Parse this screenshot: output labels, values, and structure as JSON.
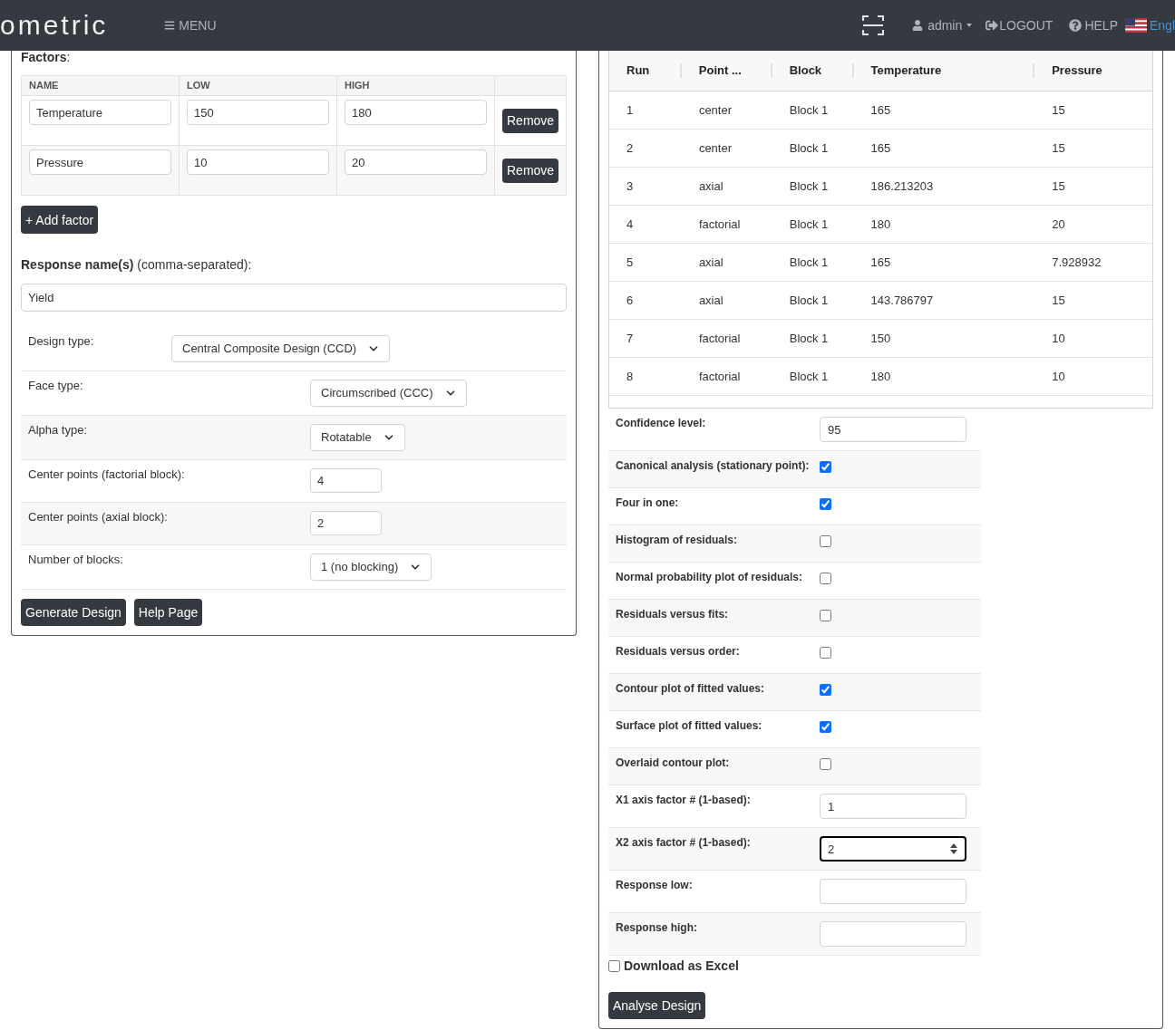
{
  "navbar": {
    "logo": "ometric",
    "menu": "MENU",
    "user": "admin",
    "logout": "LOGOUT",
    "help": "HELP",
    "language": "Engl"
  },
  "factors": {
    "title": "**Factors**:",
    "columns": [
      "NAME",
      "LOW",
      "HIGH"
    ],
    "rows": [
      {
        "name": "Temperature",
        "low": "150",
        "high": "180",
        "action": "Remove"
      },
      {
        "name": "Pressure",
        "low": "10",
        "high": "20",
        "action": "Remove"
      }
    ],
    "add_button": "+ Add factor"
  },
  "response": {
    "label": "**Response name(s)** (comma-separated):",
    "value": "Yield"
  },
  "design_type": {
    "label": "Design type:",
    "value": "Central Composite Design (CCD)"
  },
  "settings": [
    {
      "kind": "select",
      "label": "Face type:",
      "value": "Circumscribed (CCC)"
    },
    {
      "kind": "select",
      "label": "Alpha type:",
      "value": "Rotatable"
    },
    {
      "kind": "input",
      "label": "Center points (factorial block):",
      "value": "4"
    },
    {
      "kind": "input",
      "label": "Center points (axial block):",
      "value": "2"
    },
    {
      "kind": "select",
      "label": "Number of blocks:",
      "value": "1 (no blocking)"
    }
  ],
  "design_buttons": [
    "Generate Design",
    "Help Page"
  ],
  "design_table": {
    "columns": [
      "Run",
      "Point ...",
      "Block",
      "Temperature",
      "Pressure"
    ],
    "rows": [
      [
        "1",
        "center",
        "Block 1",
        "165",
        "15"
      ],
      [
        "2",
        "center",
        "Block 1",
        "165",
        "15"
      ],
      [
        "3",
        "axial",
        "Block 1",
        "186.213203",
        "15"
      ],
      [
        "4",
        "factorial",
        "Block 1",
        "180",
        "20"
      ],
      [
        "5",
        "axial",
        "Block 1",
        "165",
        "7.928932"
      ],
      [
        "6",
        "axial",
        "Block 1",
        "143.786797",
        "15"
      ],
      [
        "7",
        "factorial",
        "Block 1",
        "150",
        "10"
      ],
      [
        "8",
        "factorial",
        "Block 1",
        "180",
        "10"
      ]
    ]
  },
  "analysis_options": [
    {
      "kind": "input",
      "label": "Confidence level:",
      "value": "95",
      "focused": false
    },
    {
      "kind": "checkbox",
      "label": "Canonical analysis (stationary point):",
      "checked": true
    },
    {
      "kind": "checkbox",
      "label": "Four in one:",
      "checked": true
    },
    {
      "kind": "checkbox",
      "label": "Histogram of residuals:",
      "checked": false
    },
    {
      "kind": "checkbox",
      "label": "Normal probability plot of residuals:",
      "checked": false
    },
    {
      "kind": "checkbox",
      "label": "Residuals versus fits:",
      "checked": false
    },
    {
      "kind": "checkbox",
      "label": "Residuals versus order:",
      "checked": false
    },
    {
      "kind": "checkbox",
      "label": "Contour plot of fitted values:",
      "checked": true
    },
    {
      "kind": "checkbox",
      "label": "Surface plot of fitted values:",
      "checked": true
    },
    {
      "kind": "checkbox",
      "label": "Overlaid contour plot:",
      "checked": false
    },
    {
      "kind": "input",
      "label": "X1 axis factor # (1-based):",
      "value": "1",
      "focused": false
    },
    {
      "kind": "input",
      "label": "X2 axis factor # (1-based):",
      "value": "2",
      "focused": true
    },
    {
      "kind": "input",
      "label": "Response low:",
      "focused": false
    },
    {
      "kind": "input",
      "label": "Response high:",
      "focused": false
    }
  ],
  "download_excel": {
    "label": "Download as Excel",
    "checked": false
  },
  "analyse_button": "Analyse Design"
}
